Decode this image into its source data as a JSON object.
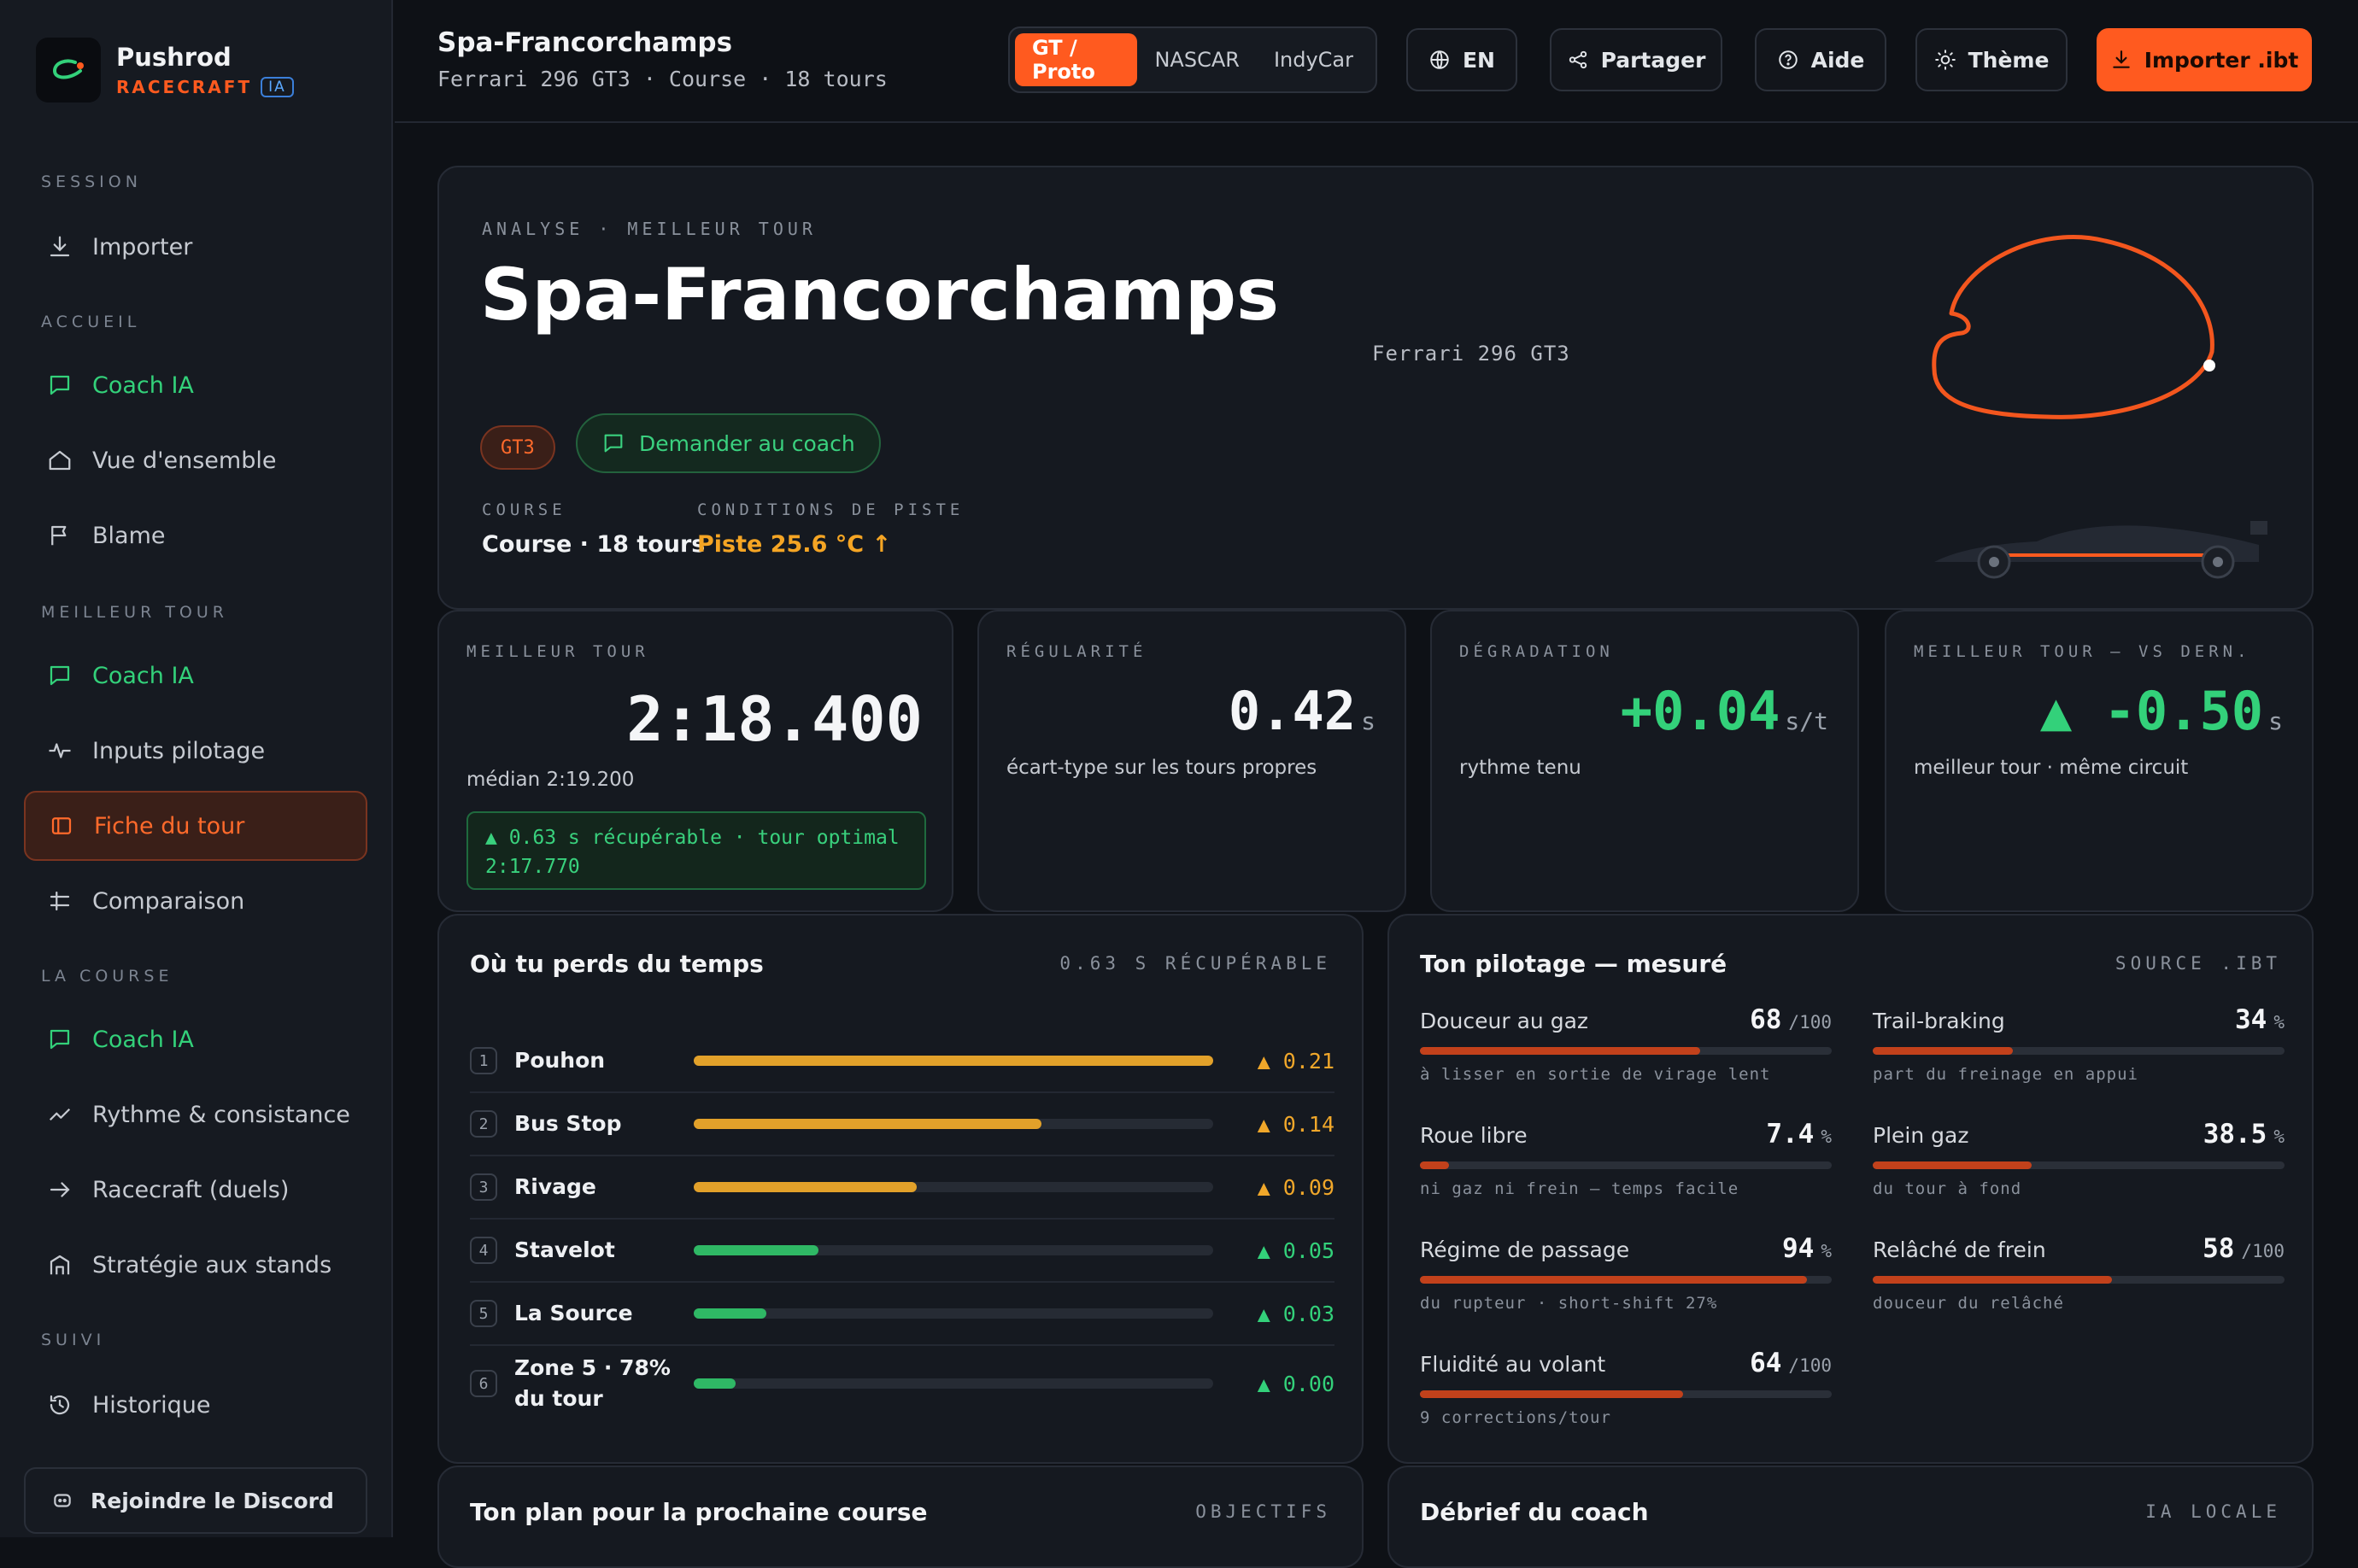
{
  "brand": {
    "name": "Pushrod",
    "sub": "RACECRAFT",
    "badge": "IA"
  },
  "sidebar": {
    "sections": {
      "session": "SESSION",
      "accueil": "ACCUEIL",
      "meilleur_tour": "MEILLEUR TOUR",
      "la_course": "LA COURSE",
      "suivi": "SUIVI"
    },
    "items": {
      "importer": "Importer",
      "coach_accueil": "Coach IA",
      "vue": "Vue d'ensemble",
      "blame": "Blame",
      "coach_tour": "Coach IA",
      "inputs": "Inputs pilotage",
      "fiche": "Fiche du tour",
      "comparaison": "Comparaison",
      "coach_course": "Coach IA",
      "rythme": "Rythme & consistance",
      "racecraft": "Racecraft (duels)",
      "strategie": "Stratégie aux stands",
      "historique": "Historique"
    },
    "discord": "Rejoindre le Discord"
  },
  "topbar": {
    "title": "Spa-Francorchamps",
    "subtitle": "Ferrari 296 GT3 · Course · 18 tours",
    "series": [
      "GT / Proto",
      "NASCAR",
      "IndyCar"
    ],
    "lang": "EN",
    "share": "Partager",
    "help": "Aide",
    "theme": "Thème",
    "import": "Importer .ibt"
  },
  "hero": {
    "kicker": "ANALYSE · MEILLEUR TOUR",
    "track": "Spa-Francorchamps",
    "car": "Ferrari 296 GT3",
    "chip": "GT3",
    "ask": "Demander au coach",
    "course_label": "COURSE",
    "course_value": "Course · 18 tours",
    "cond_label": "CONDITIONS DE PISTE",
    "cond_value": "Piste 25.6 °C ↑"
  },
  "stats": {
    "best": {
      "label": "MEILLEUR TOUR",
      "value": "2:18.400",
      "median": "médian 2:19.200",
      "recover_line1": "▲ 0.63 s récupérable · tour optimal",
      "recover_line2": "2:17.770"
    },
    "reg": {
      "label": "RÉGULARITÉ",
      "value": "0.42",
      "unit": "s",
      "desc": "écart-type sur les tours propres"
    },
    "deg": {
      "label": "DÉGRADATION",
      "value": "+0.04",
      "unit": "s/t",
      "desc": "rythme tenu"
    },
    "vs": {
      "label": "MEILLEUR TOUR — VS DERN.",
      "value": "▲ -0.50",
      "unit": "s",
      "desc": "meilleur tour · même circuit"
    }
  },
  "loss": {
    "title": "Où tu perds du temps",
    "right": "0.63 S RÉCUPÉRABLE",
    "rows": [
      {
        "n": "1",
        "name": "Pouhon",
        "delta": "▲ 0.21",
        "frac": 1.0,
        "color": "#e2a12a"
      },
      {
        "n": "2",
        "name": "Bus Stop",
        "delta": "▲ 0.14",
        "frac": 0.67,
        "color": "#e2a12a"
      },
      {
        "n": "3",
        "name": "Rivage",
        "delta": "▲ 0.09",
        "frac": 0.43,
        "color": "#e2a12a"
      },
      {
        "n": "4",
        "name": "Stavelot",
        "delta": "▲ 0.05",
        "frac": 0.24,
        "color": "#2fb865"
      },
      {
        "n": "5",
        "name": "La Source",
        "delta": "▲ 0.03",
        "frac": 0.14,
        "color": "#2fb865"
      },
      {
        "n": "6",
        "name": "Zone 5 · 78% du tour",
        "delta": "▲ 0.00",
        "frac": 0.08,
        "color": "#2fb865"
      }
    ]
  },
  "pilotage": {
    "title": "Ton pilotage — mesuré",
    "right": "SOURCE .IBT",
    "metrics": [
      {
        "name": "Douceur au gaz",
        "value": "68",
        "unit": "/100",
        "frac": 0.68,
        "hint": "à lisser en sortie de virage lent"
      },
      {
        "name": "Trail-braking",
        "value": "34",
        "unit": "%",
        "frac": 0.34,
        "hint": "part du freinage en appui"
      },
      {
        "name": "Roue libre",
        "value": "7.4",
        "unit": "%",
        "frac": 0.07,
        "hint": "ni gaz ni frein — temps facile"
      },
      {
        "name": "Plein gaz",
        "value": "38.5",
        "unit": "%",
        "frac": 0.385,
        "hint": "du tour à fond"
      },
      {
        "name": "Régime de passage",
        "value": "94",
        "unit": "%",
        "frac": 0.94,
        "hint": "du rupteur · short-shift 27%"
      },
      {
        "name": "Relâché de frein",
        "value": "58",
        "unit": "/100",
        "frac": 0.58,
        "hint": "douceur du relâché"
      },
      {
        "name": "Fluidité au volant",
        "value": "64",
        "unit": "/100",
        "frac": 0.64,
        "hint": "9 corrections/tour"
      }
    ]
  },
  "plan": {
    "title": "Ton plan pour la prochaine course",
    "right": "OBJECTIFS"
  },
  "debrief": {
    "title": "Débrief du coach",
    "right": "IA LOCALE"
  }
}
